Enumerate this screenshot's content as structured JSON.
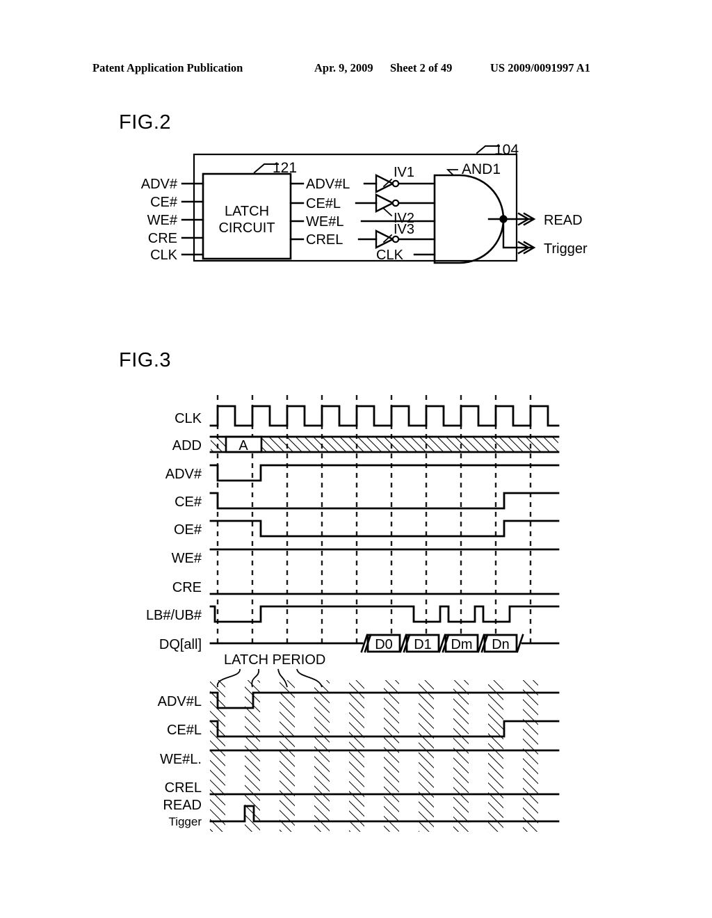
{
  "header": {
    "publication": "Patent Application Publication",
    "date": "Apr. 9, 2009",
    "sheet": "Sheet 2 of 49",
    "docnum": "US 2009/0091997 A1"
  },
  "fig2": {
    "title": "FIG.2",
    "block_ref": "121",
    "outer_ref": "104",
    "latch_label_line1": "LATCH",
    "latch_label_line2": "CIRCUIT",
    "inputs": [
      "ADV#",
      "CE#",
      "WE#",
      "CRE",
      "CLK"
    ],
    "latched": [
      "ADV#L",
      "CE#L",
      "WE#L",
      "CREL"
    ],
    "clk_gate_label": "CLK",
    "inverters": [
      "IV1",
      "IV2",
      "IV3"
    ],
    "and_gate": "AND1",
    "outputs": [
      "READ",
      "Trigger"
    ]
  },
  "fig3": {
    "title": "FIG.3",
    "annotation": "LATCH PERIOD",
    "upper_signals": [
      "CLK",
      "ADD",
      "ADV#",
      "CE#",
      "OE#",
      "WE#",
      "CRE",
      "LB#/UB#",
      "DQ[all]"
    ],
    "lower_signals": [
      "ADV#L",
      "CE#L",
      "WE#L.",
      "CREL"
    ],
    "read_label_line1": "READ",
    "read_label_line2": "Tigger",
    "address_value": "A",
    "dq_values": [
      "D0",
      "D1",
      "Dm",
      "Dn"
    ],
    "clock_cycles": 10,
    "grid_count": 10
  },
  "colors": {
    "ink": "#000000",
    "paper": "#ffffff",
    "grid": "#222222"
  }
}
